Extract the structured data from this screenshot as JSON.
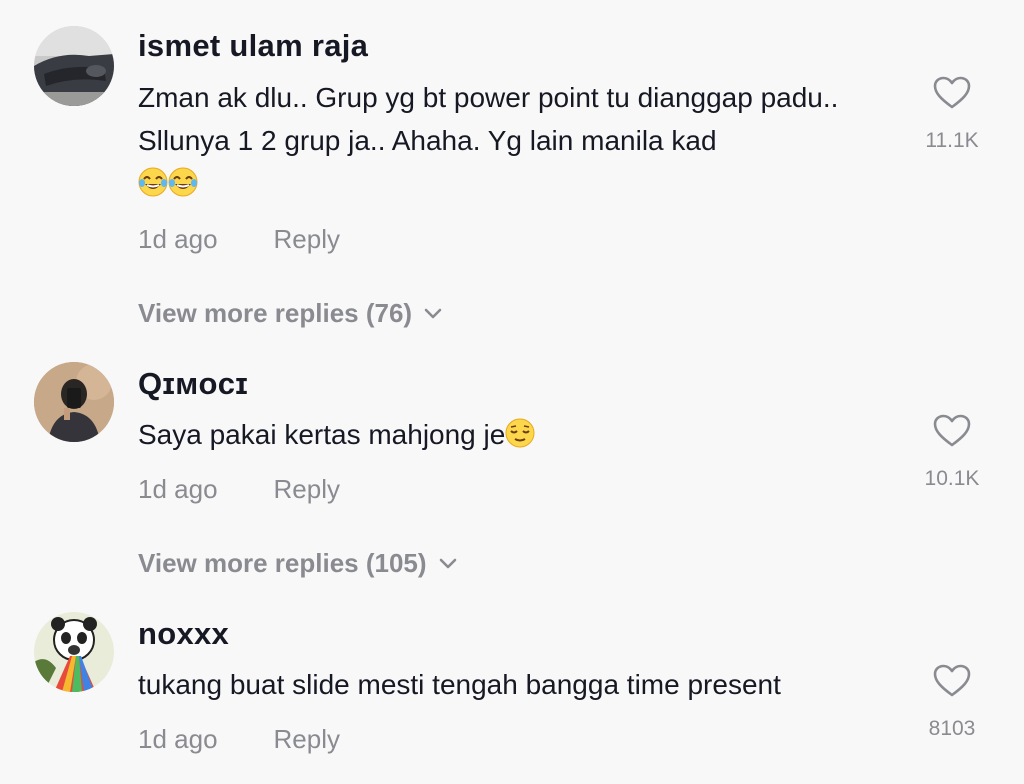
{
  "comments": [
    {
      "username": "ismet ulam raja",
      "text": "Zman ak dlu.. Grup yg bt power point tu dianggap padu.. Sllunya 1 2 grup ja.. Ahaha. Yg lain manila kad",
      "emoji_count": 2,
      "emoji": "face-with-tears-of-joy",
      "time": "1d ago",
      "reply_label": "Reply",
      "likes": "11.1K",
      "view_more": "View more replies (76)"
    },
    {
      "username": "Qɪᴍᴏᴄɪ",
      "text": "Saya pakai kertas mahjong je",
      "emoji": "relieved-face",
      "time": "1d ago",
      "reply_label": "Reply",
      "likes": "10.1K",
      "view_more": "View more replies (105)"
    },
    {
      "username": "noxxx",
      "text": "tukang buat slide mesti tengah bangga time present",
      "time": "1d ago",
      "reply_label": "Reply",
      "likes": "8103"
    }
  ],
  "colors": {
    "background": "#f8f8f8",
    "primary_text": "#161823",
    "secondary_text": "#8a8b91"
  },
  "icons": {
    "like": "heart-outline-icon",
    "expand": "chevron-down-icon"
  }
}
